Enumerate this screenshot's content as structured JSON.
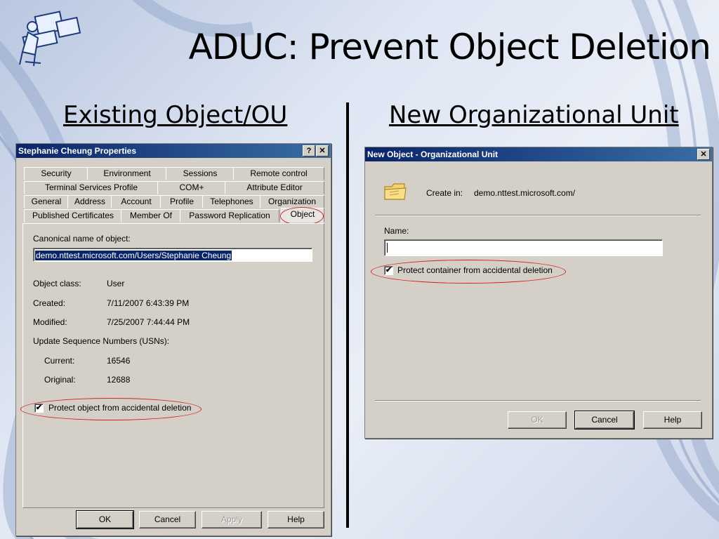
{
  "slide": {
    "title": "ADUC: Prevent Object Deletion",
    "left_heading": "Existing Object/OU",
    "right_heading": "New Organizational Unit",
    "colors": {
      "highlight_oval": "#d42020",
      "titlebar": "#0a246a"
    }
  },
  "props_dialog": {
    "title": "Stephanie Cheung Properties",
    "help_glyph": "?",
    "close_glyph": "✕",
    "tabs_row1": [
      "Security",
      "Environment",
      "Sessions",
      "Remote control"
    ],
    "tabs_row2": [
      "Terminal Services Profile",
      "COM+",
      "Attribute Editor"
    ],
    "tabs_row3": [
      "General",
      "Address",
      "Account",
      "Profile",
      "Telephones",
      "Organization"
    ],
    "tabs_row4": [
      "Published Certificates",
      "Member Of",
      "Password Replication",
      "Object"
    ],
    "active_tab": "Object",
    "canonical_label": "Canonical name of object:",
    "canonical_value": "demo.nttest.microsoft.com/Users/Stephanie Cheung",
    "object_class_label": "Object class:",
    "object_class_value": "User",
    "created_label": "Created:",
    "created_value": "7/11/2007 6:43:39 PM",
    "modified_label": "Modified:",
    "modified_value": "7/25/2007 7:44:44 PM",
    "usn_label": "Update Sequence Numbers (USNs):",
    "current_label": "Current:",
    "current_value": "16546",
    "original_label": "Original:",
    "original_value": "12688",
    "protect_label": "Protect object from accidental deletion",
    "protect_checked": true,
    "check_glyph": "✔",
    "buttons": {
      "ok": "OK",
      "cancel": "Cancel",
      "apply": "Apply",
      "help": "Help"
    }
  },
  "new_ou_dialog": {
    "title": "New Object - Organizational Unit",
    "close_glyph": "✕",
    "folder_icon": "folder-icon",
    "create_in_label": "Create in:",
    "create_in_value": "demo.nttest.microsoft.com/",
    "name_label": "Name:",
    "name_value": "",
    "protect_label": "Protect container from accidental deletion",
    "protect_checked": true,
    "check_glyph": "✔",
    "buttons": {
      "ok": "OK",
      "cancel": "Cancel",
      "help": "Help"
    }
  }
}
